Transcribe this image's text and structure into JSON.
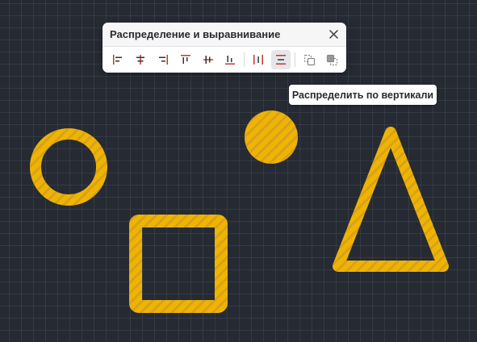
{
  "panel": {
    "title": "Распределение и выравнивание",
    "close_icon": "close-icon"
  },
  "toolbar": {
    "tools": [
      {
        "name": "align-left",
        "icon": "align-left-icon"
      },
      {
        "name": "align-horizontal-center",
        "icon": "align-horizontal-center-icon"
      },
      {
        "name": "align-right",
        "icon": "align-right-icon"
      },
      {
        "name": "align-top",
        "icon": "align-top-icon"
      },
      {
        "name": "align-vertical-center",
        "icon": "align-vertical-center-icon"
      },
      {
        "name": "align-bottom",
        "icon": "align-bottom-icon"
      },
      {
        "name": "distribute-horizontally",
        "icon": "distribute-horizontal-icon"
      },
      {
        "name": "distribute-vertically",
        "icon": "distribute-vertical-icon",
        "active": true
      },
      {
        "name": "bring-to-front",
        "icon": "bring-to-front-icon"
      },
      {
        "name": "send-to-back",
        "icon": "send-to-back-icon"
      }
    ]
  },
  "tooltip": {
    "text": "Распределить по вертикали"
  },
  "colors": {
    "canvas_bg": "#262a33",
    "shape_stripe_a": "#f0b400",
    "shape_stripe_b": "#dba81a",
    "accent_red": "#c0392b"
  },
  "canvas_shapes": [
    "ring",
    "filled-circle",
    "square-outline",
    "triangle-outline"
  ]
}
